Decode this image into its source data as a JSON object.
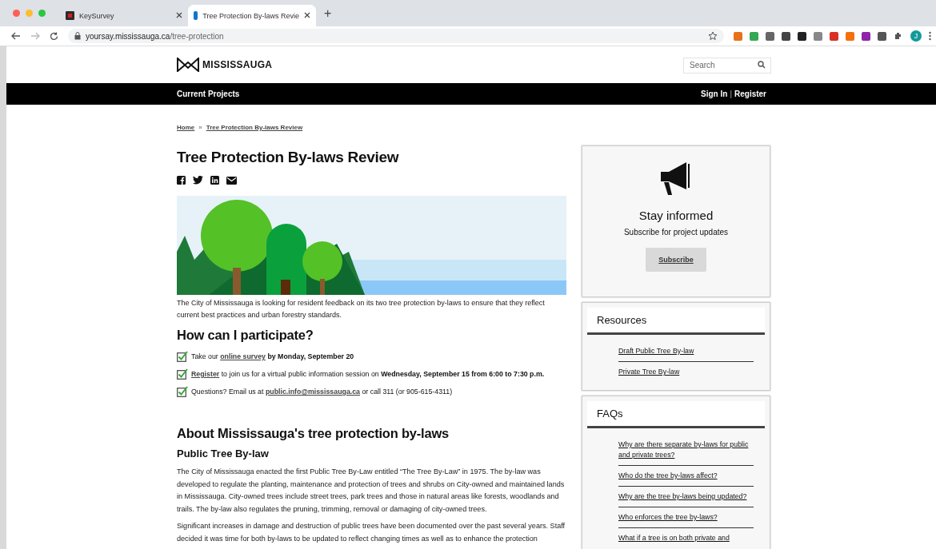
{
  "browser": {
    "tabs": [
      {
        "title": "KeySurvey",
        "selected": false
      },
      {
        "title": "Tree Protection By-laws Revie",
        "selected": true
      }
    ],
    "new_tab": "+",
    "url_host": "yoursay.mississauga.ca",
    "url_path": "/tree-protection",
    "profile_initial": "J"
  },
  "header": {
    "logo_text": "MISSISSAUGA",
    "search": {
      "placeholder": "Search"
    }
  },
  "nav": {
    "left": "Current Projects",
    "sign_in": "Sign In",
    "separator": "|",
    "register": "Register"
  },
  "breadcrumb": [
    {
      "label": "Home"
    },
    {
      "label": "Tree Protection By-laws Review"
    }
  ],
  "breadcrumb_separator": "»",
  "title": "Tree Protection By-laws Review",
  "intro": "The City of Mississauga is looking for resident feedback on its two tree protection by-laws to ensure that they reflect current best practices and urban forestry standards.",
  "participate": {
    "heading": "How can I participate?",
    "items": [
      {
        "checked": true,
        "parts": [
          {
            "kind": "text",
            "text": "Take our"
          },
          {
            "kind": "link",
            "text": "online survey"
          },
          {
            "kind": "bold",
            "text": "by Monday, September 20"
          }
        ]
      },
      {
        "checked": true,
        "parts": [
          {
            "kind": "link",
            "text": "Register"
          },
          {
            "kind": "text",
            "text": "to join us for a virtual public information session on"
          },
          {
            "kind": "bold",
            "text": "Wednesday, September 15 from 6:00 to 7:30 p.m."
          }
        ]
      },
      {
        "checked": true,
        "parts": [
          {
            "kind": "text",
            "text": "Questions? Email us at"
          },
          {
            "kind": "link",
            "text": "public.info@mississauga.ca"
          },
          {
            "kind": "text",
            "text": "or call 311 (or 905-615-4311)"
          }
        ]
      }
    ]
  },
  "about": {
    "heading": "About Mississauga's tree protection by-laws",
    "subheading": "Public Tree By-law",
    "paragraphs": [
      "The City of Mississauga enacted the first Public Tree By-Law entitled “The Tree By-Law” in 1975. The by-law was developed to regulate the planting, maintenance and protection of trees and shrubs on City-owned and maintained lands in Mississauga. City-owned trees include street trees, park trees and those in natural areas like forests, woodlands and trails. The by-law also regulates the pruning, trimming, removal or damaging of city-owned trees.",
      "Significant increases in damage and destruction of public trees have been documented over the past several years. Staff decided it was time for both by-laws to be updated to reflect changing times as well as to enhance the protection"
    ]
  },
  "stay_informed": {
    "title": "Stay informed",
    "text": "Subscribe for project updates",
    "button": "Subscribe"
  },
  "resources": {
    "heading": "Resources",
    "links": [
      "Draft Public Tree By-law",
      "Private Tree By-law"
    ]
  },
  "faqs": {
    "heading": "FAQs",
    "links": [
      "Why are there separate by-laws for public and private trees?",
      "Who do the tree by-laws affect?",
      "Why are the tree by-laws being updated?",
      "Who enforces the tree by-laws?",
      "What if a tree is on both private and"
    ]
  }
}
